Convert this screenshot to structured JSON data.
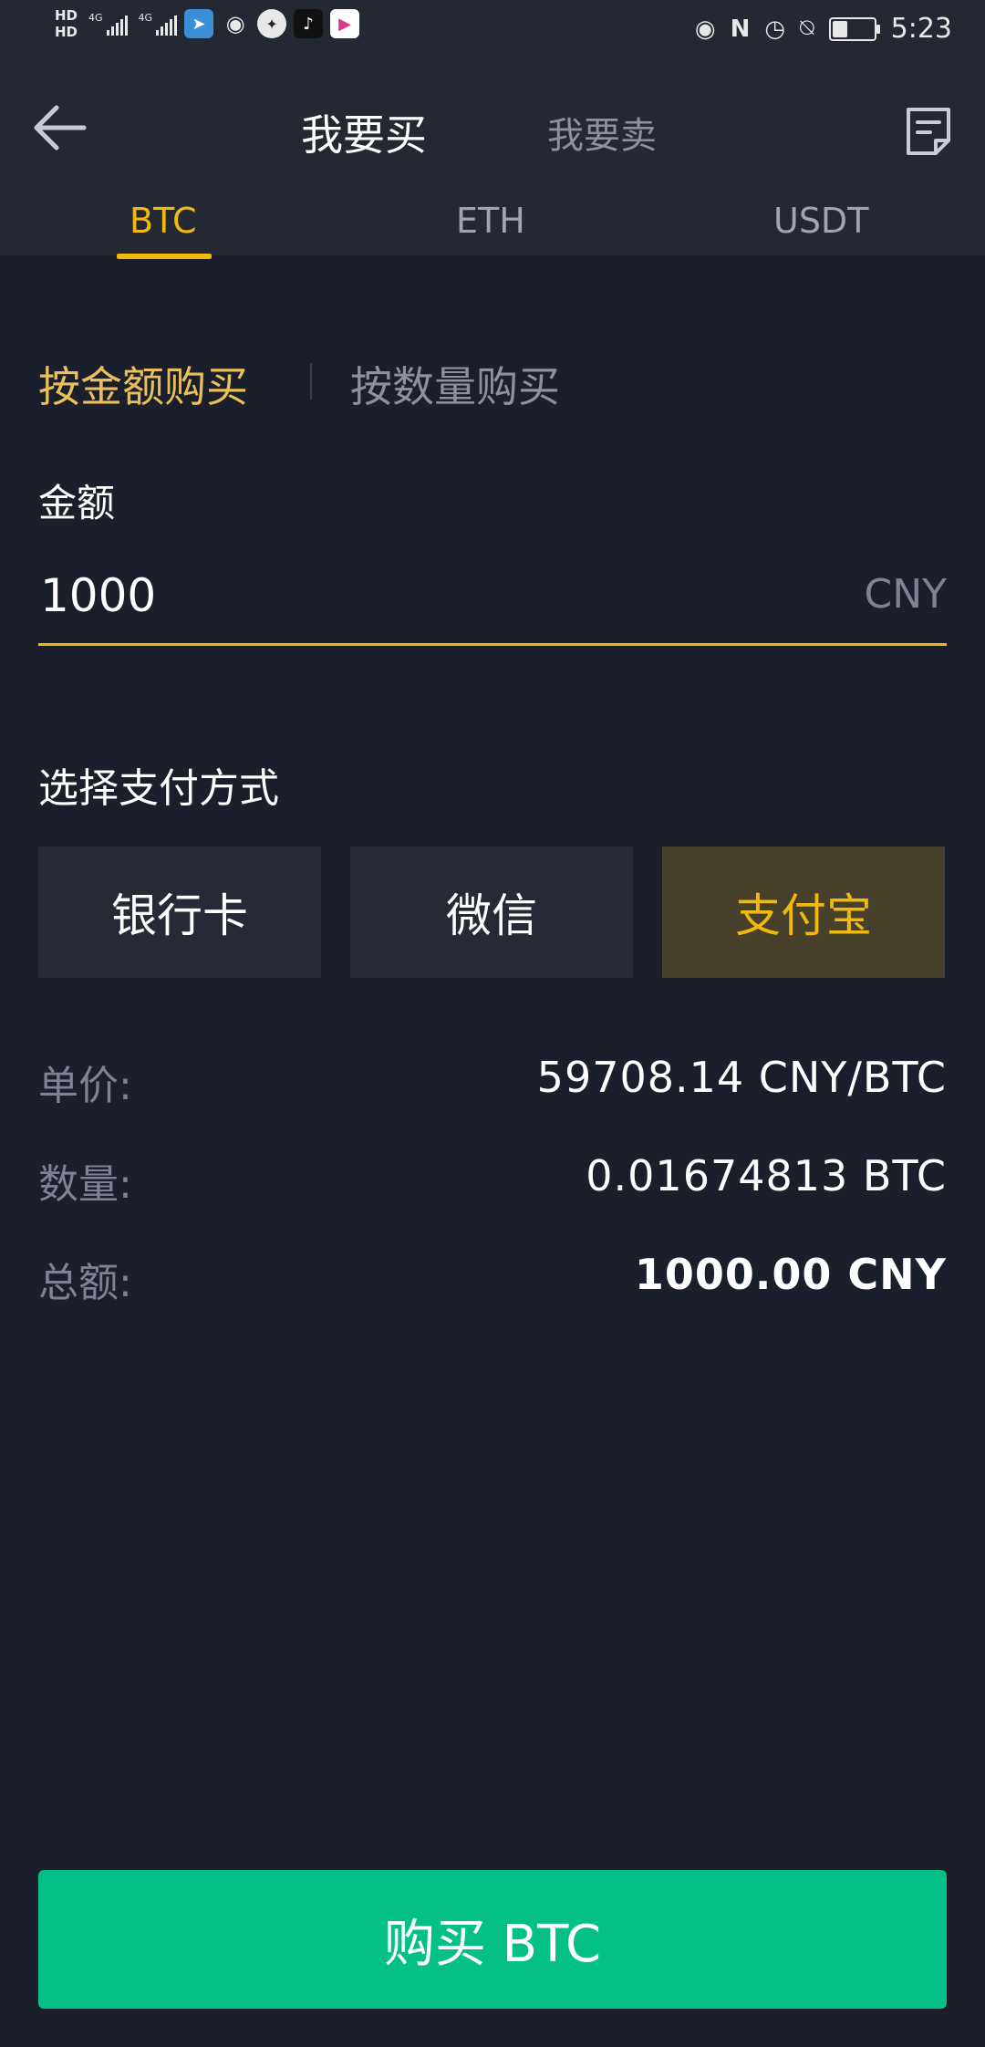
{
  "status_bar": {
    "hd1": "HD",
    "hd2": "HD",
    "signal1": "4G",
    "signal2": "4G",
    "time": "5:23",
    "battery_level": 0.35
  },
  "header": {
    "tab_buy": "我要买",
    "tab_sell": "我要卖"
  },
  "coin_tabs": [
    "BTC",
    "ETH",
    "USDT"
  ],
  "purchase_modes": {
    "by_amount": "按金额购买",
    "by_quantity": "按数量购买"
  },
  "amount": {
    "label": "金额",
    "value": "1000",
    "unit": "CNY"
  },
  "payment": {
    "label": "选择支付方式",
    "options": [
      "银行卡",
      "微信",
      "支付宝"
    ],
    "selected": "支付宝"
  },
  "summary": {
    "price_label": "单价:",
    "price_value": "59708.14 CNY/BTC",
    "qty_label": "数量:",
    "qty_value": "0.01674813 BTC",
    "total_label": "总额:",
    "total_value": "1000.00 CNY"
  },
  "buy_button": "购买 BTC",
  "colors": {
    "accent": "#f0b90b",
    "buy": "#04c087",
    "background": "#1b1e2b"
  }
}
